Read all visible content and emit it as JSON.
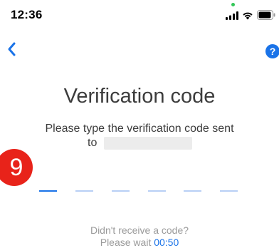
{
  "status_bar": {
    "time": "12:36",
    "privacy_indicator_color": "#34c759",
    "icons": [
      "cellular-signal-icon",
      "wifi-icon",
      "battery-icon"
    ]
  },
  "nav": {
    "back_icon": "chevron-left-icon",
    "help_icon": "question-mark-icon",
    "help_glyph": "?"
  },
  "title": "Verification code",
  "instruction": {
    "line1": "Please type the verification code sent",
    "line2_prefix": "to"
  },
  "step_badge": "9",
  "code_input": {
    "length": 6,
    "entered": "",
    "active_index": 0
  },
  "resend": {
    "prompt": "Didn't receive a code?",
    "wait_label": "Please wait",
    "countdown": "00:50"
  },
  "colors": {
    "accent": "#1a73e8",
    "slot_inactive": "#b8cff5",
    "badge": "#e8231a",
    "text": "#3c3c3c",
    "muted_text": "#9a9a9a"
  }
}
